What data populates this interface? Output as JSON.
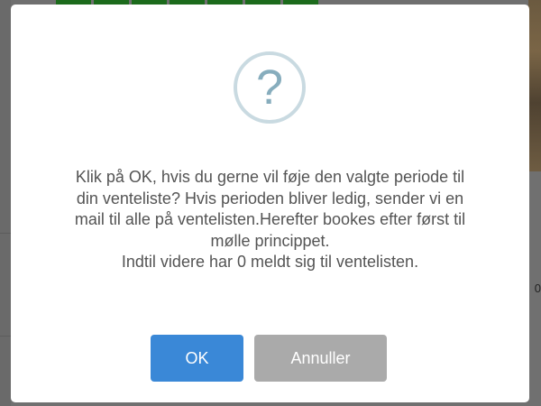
{
  "background": {
    "right_edge_text": "0"
  },
  "dialog": {
    "icon": "question-icon",
    "icon_glyph": "?",
    "message_lines": [
      "Klik på OK, hvis du gerne vil føje den valgte periode til",
      "din venteliste? Hvis perioden bliver ledig, sender vi en",
      "mail til alle på ventelisten.Herefter bookes efter først til",
      "mølle princippet.",
      "Indtil videre har 0 meldt sig til ventelisten."
    ],
    "ok_label": "OK",
    "cancel_label": "Annuller"
  },
  "colors": {
    "ok_button": "#3a88d7",
    "cancel_button": "#aaaaaa",
    "icon_ring": "#c9dae1",
    "icon_glyph": "#87adbd",
    "message_text": "#545454"
  }
}
